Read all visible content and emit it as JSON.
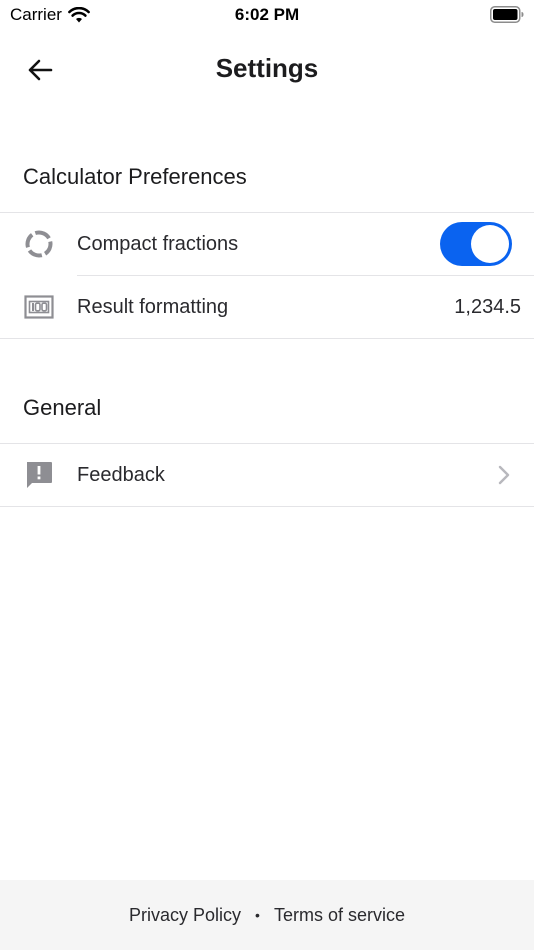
{
  "status_bar": {
    "carrier": "Carrier",
    "time": "6:02 PM",
    "wifi_icon": "wifi-icon",
    "battery_icon": "battery-full-icon"
  },
  "header": {
    "title": "Settings",
    "back_icon": "arrow-left-icon"
  },
  "sections": [
    {
      "title": "Calculator Preferences",
      "items": [
        {
          "label": "Compact fractions",
          "icon": "circle-dashed-icon",
          "control": "toggle",
          "toggle_on": true
        },
        {
          "label": "Result formatting",
          "icon": "number-format-icon",
          "control": "value",
          "value": "1,234.5"
        }
      ]
    },
    {
      "title": "General",
      "items": [
        {
          "label": "Feedback",
          "icon": "feedback-icon",
          "control": "chevron"
        }
      ]
    }
  ],
  "footer": {
    "privacy": "Privacy Policy",
    "separator": "•",
    "terms": "Terms of service"
  },
  "colors": {
    "accent": "#0a63f0",
    "background": "#ffffff",
    "footer_background": "#f5f5f5",
    "divider": "#e4e4e7",
    "icon_gray": "#8e8e93"
  }
}
